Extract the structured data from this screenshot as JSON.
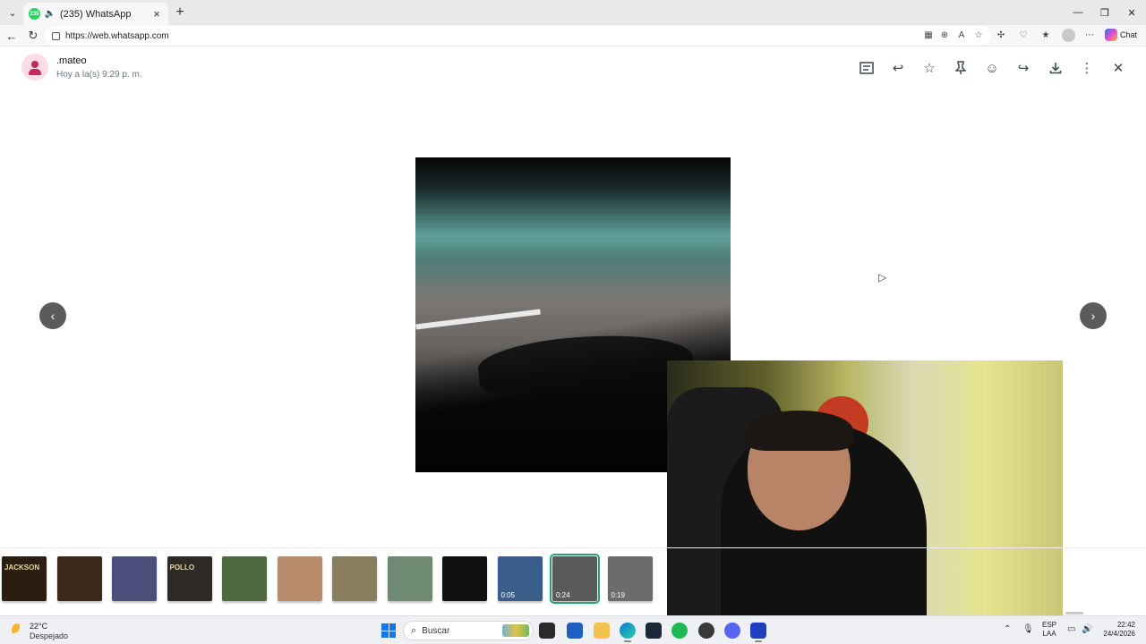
{
  "browser": {
    "tab": {
      "title": "(235) WhatsApp",
      "favicon_label": "235"
    },
    "url": "https://web.whatsapp.com",
    "chat_label": "Chat"
  },
  "viewer": {
    "contact_name": ".mateo",
    "timestamp": "Hoy a la(s) 9:29 p. m.",
    "tools": [
      "message-text-icon",
      "reply-icon",
      "star-icon",
      "pin-icon",
      "emoji-icon",
      "forward-icon",
      "download-icon",
      "more-icon",
      "close-icon"
    ]
  },
  "thumbnails": [
    {
      "label": "JACKSON",
      "duration": "",
      "color": "#2a1d12"
    },
    {
      "label": "",
      "duration": "",
      "color": "#3b2a1a"
    },
    {
      "label": "",
      "duration": "",
      "color": "#4a4e7a"
    },
    {
      "label": "POLLO",
      "duration": "",
      "color": "#2d2a26"
    },
    {
      "label": "",
      "duration": "",
      "color": "#4f6a3e"
    },
    {
      "label": "",
      "duration": "",
      "color": "#b98c6c"
    },
    {
      "label": "",
      "duration": "",
      "color": "#8a7e5e"
    },
    {
      "label": "",
      "duration": "",
      "color": "#6e8a73"
    },
    {
      "label": "",
      "duration": "",
      "color": "#111111"
    },
    {
      "label": "",
      "duration": "0:05",
      "color": "#3a5e8a"
    },
    {
      "label": "",
      "duration": "0:24",
      "color": "#5a5a5a",
      "active": true
    },
    {
      "label": "",
      "duration": "0:19",
      "color": "#6b6b6b"
    }
  ],
  "taskbar": {
    "temperature": "22°C",
    "weather": "Despejado",
    "search_label": "Buscar",
    "language_top": "ESP",
    "language_bottom": "LAA",
    "time": "22:42",
    "date": "24/4/2026"
  },
  "colors": {
    "accent_green": "#25a56a",
    "avatar_bg": "#f9dde3",
    "avatar_fg": "#c2285f"
  }
}
